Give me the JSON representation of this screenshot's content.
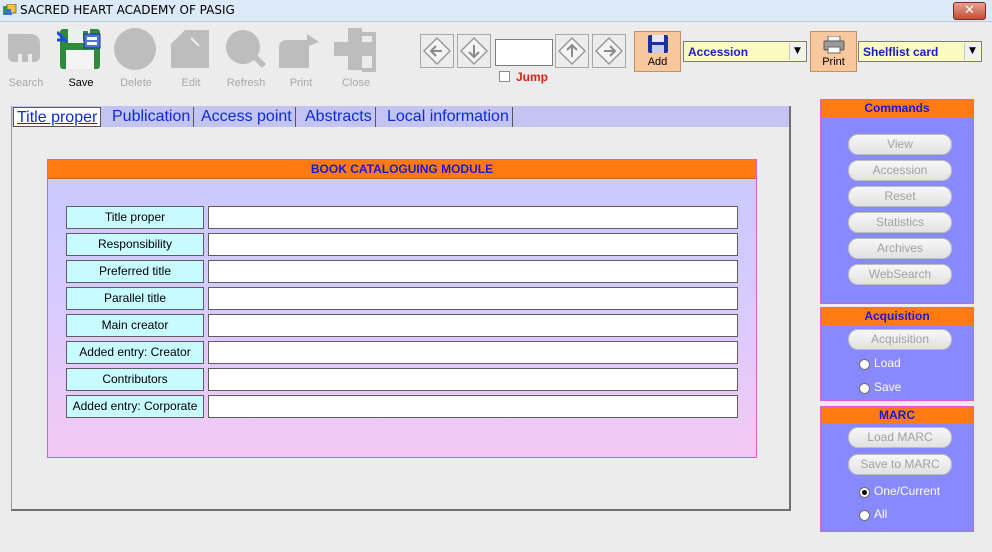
{
  "window": {
    "title": "SACRED HEART ACADEMY OF PASIG",
    "close_label": "✕"
  },
  "toolbar": {
    "buttons": [
      {
        "label": "Search",
        "icon": "search-icon",
        "enabled": false
      },
      {
        "label": "Save",
        "icon": "save-icon",
        "enabled": true
      },
      {
        "label": "Delete",
        "icon": "delete-icon",
        "enabled": false
      },
      {
        "label": "Edit",
        "icon": "edit-icon",
        "enabled": false
      },
      {
        "label": "Refresh",
        "icon": "refresh-icon",
        "enabled": false
      },
      {
        "label": "Print",
        "icon": "print-icon",
        "enabled": false
      },
      {
        "label": "Close",
        "icon": "close-icon",
        "enabled": false
      }
    ],
    "nav": [
      "arrow-left-icon",
      "arrow-down-icon",
      "arrow-up-icon",
      "arrow-right-icon"
    ],
    "jump_label": "Jump",
    "jump_value": "",
    "add_label": "Add",
    "accession_select": "Accession",
    "print_label": "Print",
    "card_select": "Shelflist card"
  },
  "tabs": [
    "Title proper",
    "Publication",
    "Access point",
    "Abstracts",
    "Local information"
  ],
  "book_module": {
    "header": "BOOK CATALOGUING MODULE",
    "fields": [
      {
        "label": "Title proper",
        "value": ""
      },
      {
        "label": "Responsibility",
        "value": ""
      },
      {
        "label": "Preferred title",
        "value": ""
      },
      {
        "label": "Parallel title",
        "value": ""
      },
      {
        "label": "Main creator",
        "value": ""
      },
      {
        "label": "Added entry: Creator",
        "value": ""
      },
      {
        "label": "Contributors",
        "value": ""
      },
      {
        "label": "Added entry: Corporate",
        "value": ""
      }
    ]
  },
  "commands": {
    "header": "Commands",
    "buttons": [
      "View",
      "Accession",
      "Reset",
      "Statistics",
      "Archives",
      "WebSearch"
    ]
  },
  "acquisition": {
    "header": "Acquisition",
    "button": "Acquisition",
    "options": [
      "Load",
      "Save"
    ]
  },
  "marc": {
    "header": "MARC",
    "buttons": [
      "Load MARC",
      "Save to MARC"
    ],
    "options": [
      "One/Current",
      "All"
    ],
    "selected": "One/Current"
  },
  "colors": {
    "accent_orange": "#ff7a12",
    "panel_blue": "#8888ff",
    "label_blue": "#1b1bd0",
    "field_label_bg": "#c7fbff"
  }
}
